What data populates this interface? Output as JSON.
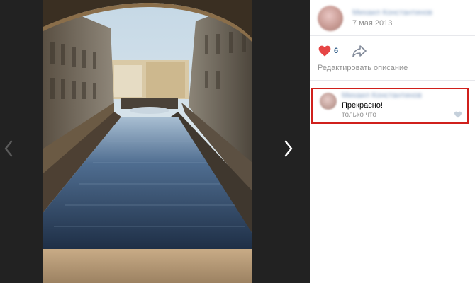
{
  "post": {
    "author": "Михаил Константинов",
    "date": "7 мая 2013",
    "likes": "6",
    "edit_description": "Редактировать описание"
  },
  "comment": {
    "author": "Михаил Константинов",
    "text": "Прекрасно!",
    "time": "только что"
  },
  "colors": {
    "like_red": "#e64646",
    "link_blue": "#2a5885",
    "highlight_border": "#d0201c"
  }
}
